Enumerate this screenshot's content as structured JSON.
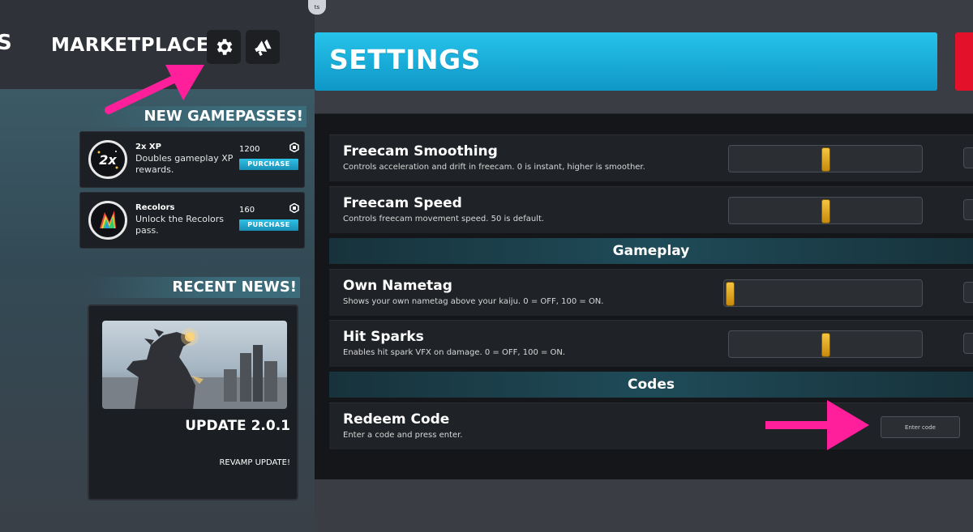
{
  "topbar": {
    "nav_partial": "S",
    "marketplace": "MARKETPLACE",
    "chip_text": "ts",
    "icons": [
      "gear-icon",
      "megaphone-icon"
    ]
  },
  "gamepasses": {
    "heading": "NEW GAMEPASSES!",
    "items": [
      {
        "title": "2x XP",
        "description": "Doubles gameplay XP rewards.",
        "price": "1200",
        "button": "PURCHASE",
        "icon": "2x-xp-badge-icon"
      },
      {
        "title": "Recolors",
        "description": "Unlock the Recolors pass.",
        "price": "160",
        "button": "PURCHASE",
        "icon": "recolors-badge-icon"
      }
    ]
  },
  "news": {
    "heading": "RECENT NEWS!",
    "title": "UPDATE 2.0.1",
    "subtitle": "REVAMP UPDATE!"
  },
  "settings": {
    "title": "SETTINGS",
    "rows": [
      {
        "title": "Freecam Smoothing",
        "description": "Controls acceleration and drift in freecam. 0 is instant, higher is smoother.",
        "value_fraction": 0.5
      },
      {
        "title": "Freecam Speed",
        "description": "Controls freecam movement speed. 50 is default.",
        "value_fraction": 0.5
      }
    ],
    "gameplay_header": "Gameplay",
    "gameplay_rows": [
      {
        "title": "Own Nametag",
        "description": "Shows your own nametag above your kaiju. 0 = OFF, 100 = ON.",
        "value_fraction": 0.0
      },
      {
        "title": "Hit Sparks",
        "description": "Enables hit spark VFX on damage. 0 = OFF, 100 = ON.",
        "value_fraction": 0.5
      }
    ],
    "codes_header": "Codes",
    "redeem": {
      "title": "Redeem Code",
      "description": "Enter a code and press enter.",
      "placeholder": "Enter code"
    }
  },
  "colors": {
    "accent_cyan": "#1aaede",
    "close_red": "#e3122a",
    "slider_gold": "#e5ab1f",
    "annotation_pink": "#ff1f9a"
  }
}
